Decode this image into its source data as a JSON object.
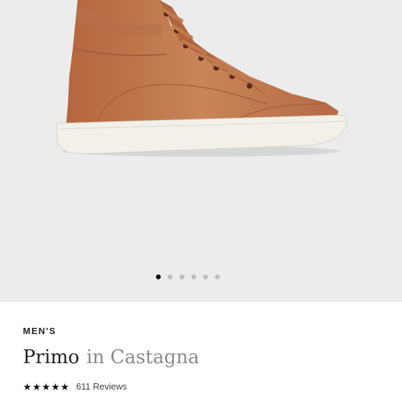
{
  "product": {
    "category": "MEN'S",
    "name": "Primo",
    "color_text": "in Castagna",
    "rating": 5,
    "reviews_label": "611 Reviews"
  },
  "carousel": {
    "slide_count": 6,
    "active_index": 0
  },
  "colors": {
    "hero_background": "#ececec",
    "leather": "#c27a52",
    "sole": "#f3f0ea",
    "active_dot": "#111111",
    "inactive_dot": "#bdbdbd"
  },
  "icons": {
    "star": "star-icon"
  }
}
